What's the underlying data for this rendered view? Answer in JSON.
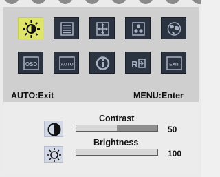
{
  "menu": {
    "items": [
      {
        "name": "brightness-contrast",
        "icon": "sun-icon"
      },
      {
        "name": "image-settings",
        "icon": "lines-icon"
      },
      {
        "name": "position",
        "icon": "move-icon"
      },
      {
        "name": "color",
        "icon": "color-dots-icon"
      },
      {
        "name": "language",
        "icon": "globe-icon"
      },
      {
        "name": "osd",
        "icon": "osd-icon",
        "text": "OSD"
      },
      {
        "name": "auto",
        "icon": "auto-icon",
        "text": "AUTO"
      },
      {
        "name": "information",
        "icon": "info-icon"
      },
      {
        "name": "reset",
        "icon": "reset-icon",
        "text": "R"
      },
      {
        "name": "exit",
        "icon": "exit-icon",
        "text": "EXIT"
      }
    ],
    "active_index": 0
  },
  "hints": {
    "auto_label": "AUTO:Exit",
    "menu_label": "MENU:Enter"
  },
  "controls": {
    "contrast": {
      "label": "Contrast",
      "value": "50",
      "level": 0.5,
      "icon": "contrast-icon"
    },
    "brightness": {
      "label": "Brightness",
      "value": "100",
      "level": 1.0,
      "icon": "brightness-icon"
    }
  },
  "colors": {
    "tile": "#2c3340",
    "active_tile": "#dfe56a",
    "panel": "#cfcfcf"
  }
}
